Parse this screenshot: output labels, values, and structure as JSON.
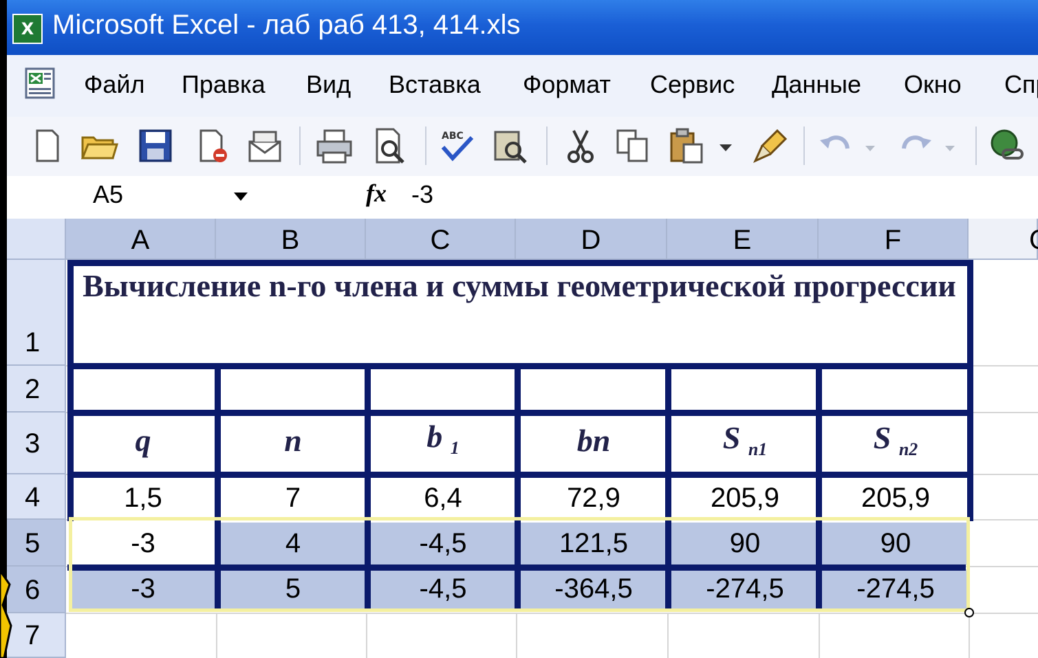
{
  "window": {
    "title": "Microsoft Excel - лаб раб 413, 414.xls"
  },
  "menu": {
    "items": [
      "Файл",
      "Правка",
      "Вид",
      "Вставка",
      "Формат",
      "Сервис",
      "Данные",
      "Окно",
      "Спр"
    ]
  },
  "toolbar": {
    "icons": [
      "new-icon",
      "open-icon",
      "save-icon",
      "permission-icon",
      "email-icon",
      "print-icon",
      "print-preview-icon",
      "spelling-icon",
      "research-icon",
      "cut-icon",
      "copy-icon",
      "paste-icon",
      "format-painter-icon",
      "undo-icon",
      "redo-icon",
      "hyperlink-icon"
    ]
  },
  "formula_bar": {
    "name_box": "A5",
    "fx": "fx",
    "value": "-3"
  },
  "columns": [
    "A",
    "B",
    "C",
    "D",
    "E",
    "F",
    "G"
  ],
  "rows": [
    "1",
    "2",
    "3",
    "4",
    "5",
    "6",
    "7"
  ],
  "sheet": {
    "title": "Вычисление n-го члена и суммы геометрической прогрессии",
    "headers": [
      {
        "main": "q",
        "sub": ""
      },
      {
        "main": "n",
        "sub": ""
      },
      {
        "main": "b",
        "sub": "1"
      },
      {
        "main": "bn",
        "sub": ""
      },
      {
        "main": "S",
        "sub": "n1"
      },
      {
        "main": "S",
        "sub": "n2"
      }
    ],
    "data": [
      [
        "1,5",
        "7",
        "6,4",
        "72,9",
        "205,9",
        "205,9"
      ],
      [
        "-3",
        "4",
        "-4,5",
        "121,5",
        "90",
        "90"
      ],
      [
        "-3",
        "5",
        "-4,5",
        "-364,5",
        "-274,5",
        "-274,5"
      ]
    ]
  },
  "selection": {
    "active_cell": "A5",
    "range": "A5:F6"
  }
}
